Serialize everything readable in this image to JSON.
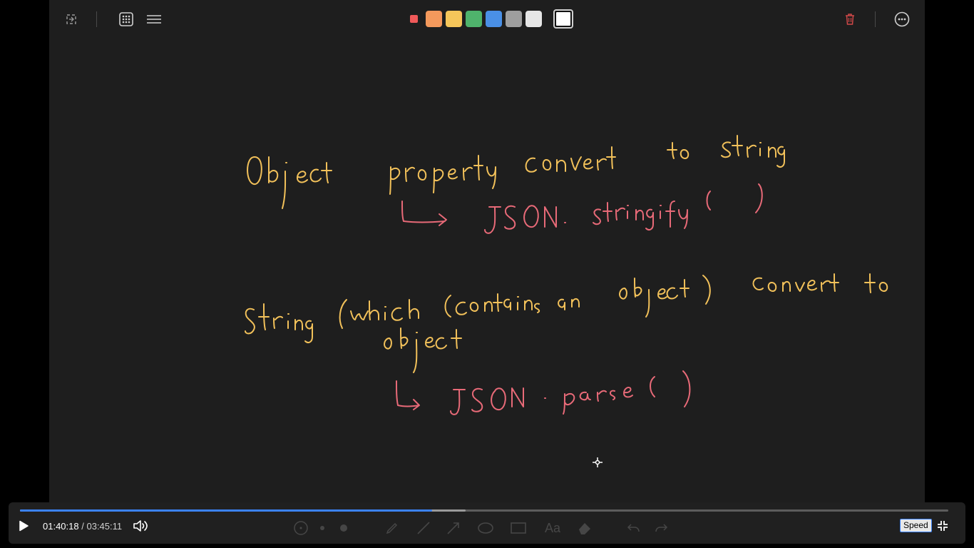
{
  "toolbar": {
    "colors": [
      "#f05a5a",
      "#f4995c",
      "#f5c65a",
      "#4fb36c",
      "#4a90e6",
      "#9e9e9e",
      "#e6e6e6",
      "#ffffff"
    ],
    "icons": [
      "fit-screen-icon",
      "grid-icon",
      "menu-icon",
      "trash-icon",
      "more-options-icon"
    ]
  },
  "whiteboard": {
    "line1": "Object property convert to string",
    "line2": "↳ JSON.stringify( )",
    "line3": "String (which contains an object) convert to",
    "line4": "object",
    "line5": "↳ JSON.parse( )",
    "ink_colors": {
      "yellow": "#f2c15a",
      "pink": "#e86a78"
    }
  },
  "player": {
    "current_time": "01:40:18",
    "separator": "/",
    "total_time": "03:45:11",
    "progress": 0.444,
    "buffered": 0.48,
    "speed_label": "Speed",
    "accent": "#3b82f6"
  }
}
